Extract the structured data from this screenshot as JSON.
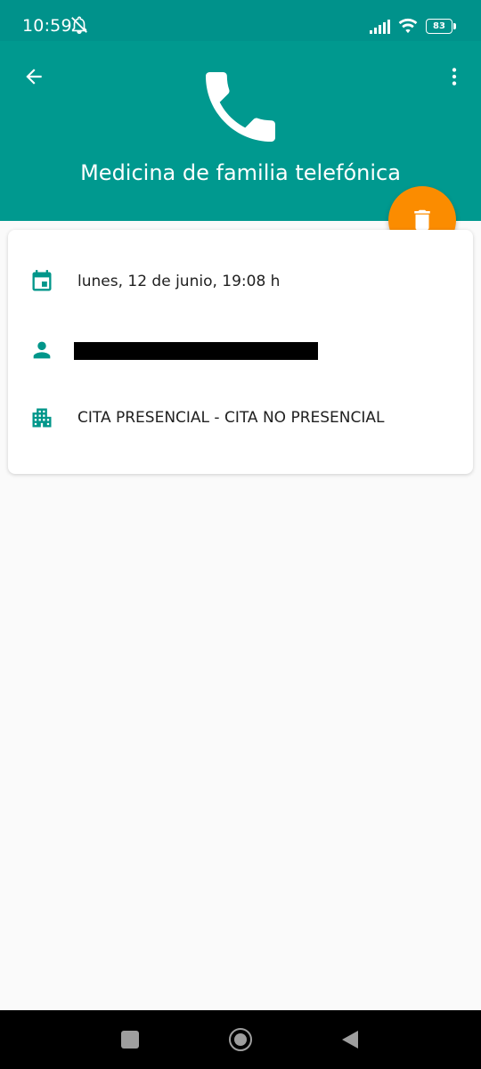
{
  "status_bar": {
    "time": "10:59",
    "battery_level": "83",
    "icons": [
      "mute-icon",
      "signal-icon",
      "wifi-icon",
      "battery-icon"
    ]
  },
  "header": {
    "title": "Medicina de familia telefónica",
    "hero_icon": "phone-icon",
    "back_icon": "arrow-back-icon",
    "menu_icon": "more-vert-icon",
    "background_color": "#00998f"
  },
  "fab": {
    "icon": "delete-icon",
    "color": "#fb8c00"
  },
  "appointment": {
    "date_time": "lunes, 12 de junio, 19:08 h",
    "patient_name_redacted": true,
    "center": "CITA PRESENCIAL - CITA NO PRESENCIAL",
    "icon_color": "#00968a"
  },
  "nav_bar": {
    "buttons": [
      "recents",
      "home",
      "back"
    ]
  }
}
